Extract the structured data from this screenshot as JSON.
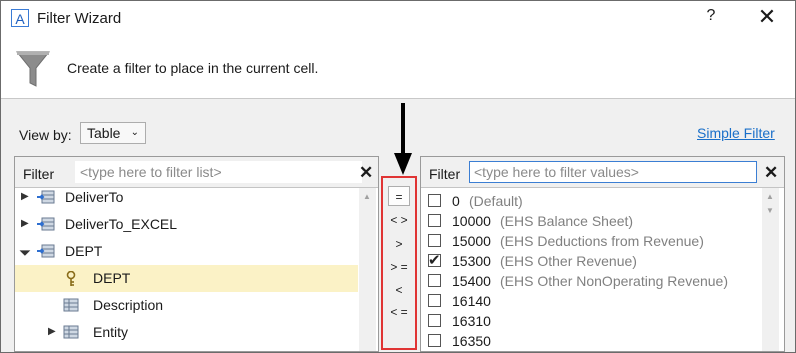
{
  "window": {
    "app_icon_letter": "A",
    "title": "Filter Wizard",
    "help_label": "?",
    "close_label": "✕"
  },
  "header": {
    "icon": "funnel-icon",
    "text": "Create a filter to place in the current cell."
  },
  "view_by": {
    "label": "View by:",
    "selected": "Table"
  },
  "simple_filter_link": "Simple Filter",
  "left_panel": {
    "filter_label": "Filter",
    "filter_placeholder": "<type here to filter list>",
    "clear_icon": "close-icon",
    "items": [
      {
        "label": "DeliverTo",
        "expander": "collapsed",
        "icon": "table-link-icon"
      },
      {
        "label": "DeliverTo_EXCEL",
        "expander": "collapsed",
        "icon": "table-link-icon"
      },
      {
        "label": "DEPT",
        "expander": "expanded",
        "icon": "table-link-icon"
      },
      {
        "label": "DEPT",
        "expander": "none",
        "icon": "key-icon",
        "selected": true
      },
      {
        "label": "Description",
        "expander": "none",
        "icon": "table-icon"
      },
      {
        "label": "Entity",
        "expander": "collapsed",
        "icon": "table-icon"
      }
    ]
  },
  "operators": [
    "=",
    "< >",
    ">",
    "> =",
    "<",
    "< ="
  ],
  "right_panel": {
    "filter_label": "Filter",
    "filter_placeholder": "<type here to filter values>",
    "clear_icon": "close-icon",
    "values": [
      {
        "code": "0",
        "desc": "(Default)",
        "checked": false
      },
      {
        "code": "10000",
        "desc": "(EHS Balance Sheet)",
        "checked": false
      },
      {
        "code": "15000",
        "desc": "(EHS Deductions from Revenue)",
        "checked": false
      },
      {
        "code": "15300",
        "desc": "(EHS Other Revenue)",
        "checked": true
      },
      {
        "code": "15400",
        "desc": "(EHS Other NonOperating Revenue)",
        "checked": false
      },
      {
        "code": "16140",
        "desc": "",
        "checked": false
      },
      {
        "code": "16310",
        "desc": "",
        "checked": false
      },
      {
        "code": "16350",
        "desc": "",
        "checked": false
      }
    ]
  },
  "colors": {
    "highlight_box": "#e03434",
    "selected_row": "#fbf2c6",
    "link": "#1a6fc9",
    "description_text": "#808080"
  }
}
